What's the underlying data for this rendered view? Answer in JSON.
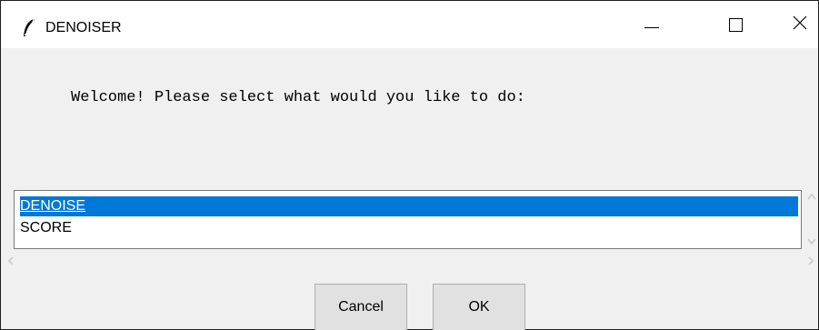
{
  "window": {
    "title": "DENOISER",
    "icon": "feather-icon",
    "controls": [
      "minimize-icon",
      "maximize-icon",
      "close-icon"
    ]
  },
  "prompt": {
    "text": "Welcome! Please select what would you like to do:"
  },
  "listbox": {
    "items": [
      {
        "label": "DENOISE",
        "selected": true
      },
      {
        "label": "SCORE",
        "selected": false
      }
    ]
  },
  "buttons": {
    "cancel_label": "Cancel",
    "ok_label": "OK"
  },
  "colors": {
    "selection": "#0078d7",
    "window_bg": "#f0f0f0",
    "titlebar_bg": "#ffffff"
  }
}
